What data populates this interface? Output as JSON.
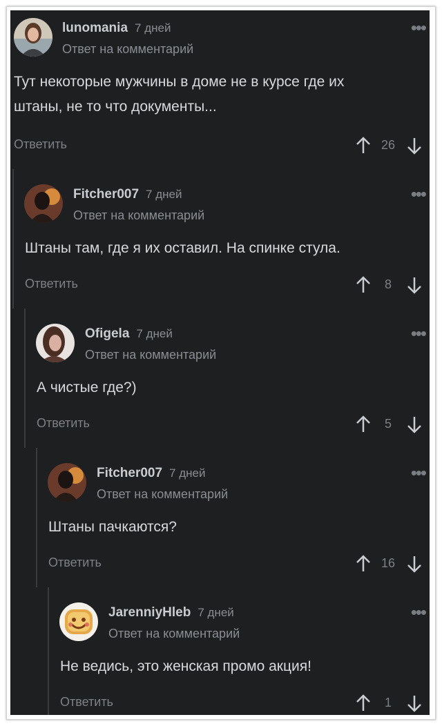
{
  "comments": [
    {
      "author": "lunomania",
      "time": "7 дней",
      "reply_label": "Ответ на комментарий",
      "text_lines": [
        "Тут некоторые мужчины в доме не в курсе где их",
        "штаны, не то что документы..."
      ],
      "action": "Ответить",
      "score": "26",
      "avatar": "woman-portrait-avatar"
    },
    {
      "author": "Fitcher007",
      "time": "7 дней",
      "reply_label": "Ответ на комментарий",
      "text_lines": [
        "Штаны там, где я их оставил. На спинке стула."
      ],
      "action": "Ответить",
      "score": "8",
      "avatar": "dark-figure-avatar"
    },
    {
      "author": "Ofigela",
      "time": "7 дней",
      "reply_label": "Ответ на комментарий",
      "text_lines": [
        "А чистые где?)"
      ],
      "action": "Ответить",
      "score": "5",
      "avatar": "girl-avatar"
    },
    {
      "author": "Fitcher007",
      "time": "7 дней",
      "reply_label": "Ответ на комментарий",
      "text_lines": [
        "Штаны пачкаются?"
      ],
      "action": "Ответить",
      "score": "16",
      "avatar": "dark-figure-avatar"
    },
    {
      "author": "JarenniyHleb",
      "time": "7 дней",
      "reply_label": "Ответ на комментарий",
      "text_lines": [
        "Не ведись, это женская промо акция!"
      ],
      "action": "Ответить",
      "score": "1",
      "avatar": "smiling-toast-avatar"
    }
  ],
  "colors": {
    "background": "#1d1f21",
    "text": "#d7d9dc",
    "muted": "#8a8d92",
    "thread_line": "#3a3c3f"
  }
}
